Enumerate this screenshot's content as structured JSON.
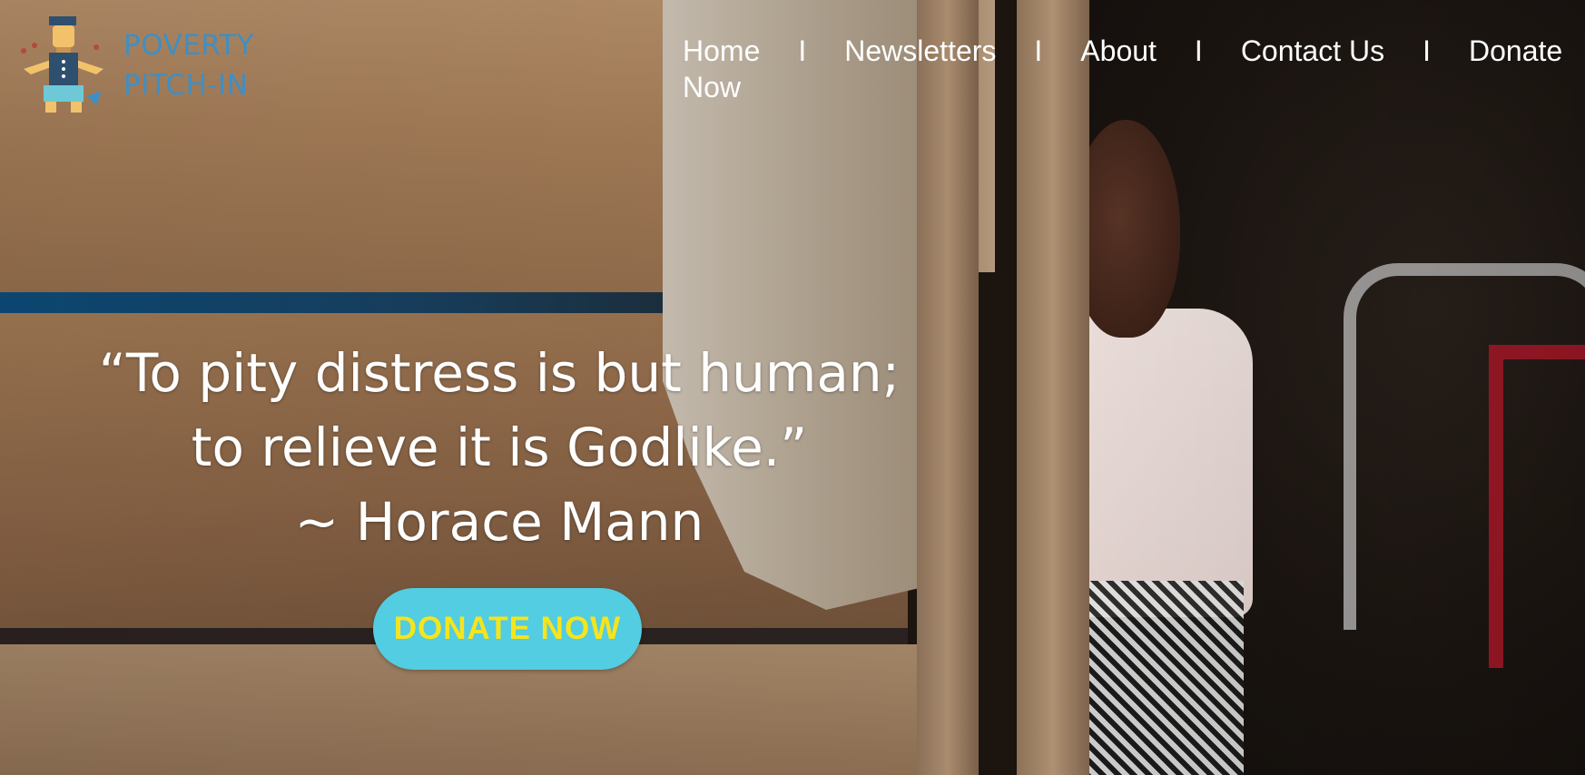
{
  "logo": {
    "line1": "POVERTY",
    "line2": "PITCH-IN",
    "icon": "volunteer-figure-icon"
  },
  "nav": {
    "items": [
      "Home",
      "Newsletters",
      "About",
      "Contact Us",
      "Donate Now"
    ],
    "separator": "I"
  },
  "hero": {
    "quote_line1": "“To pity distress is but human;",
    "quote_line2": "to relieve it is Godlike.”",
    "attribution": "~ Horace Mann",
    "cta_label": "DONATE NOW"
  },
  "colors": {
    "logo_text": "#3f8fc4",
    "button_bg": "#52cde1",
    "button_text": "#f6e41c",
    "nav_text": "#ffffff"
  }
}
